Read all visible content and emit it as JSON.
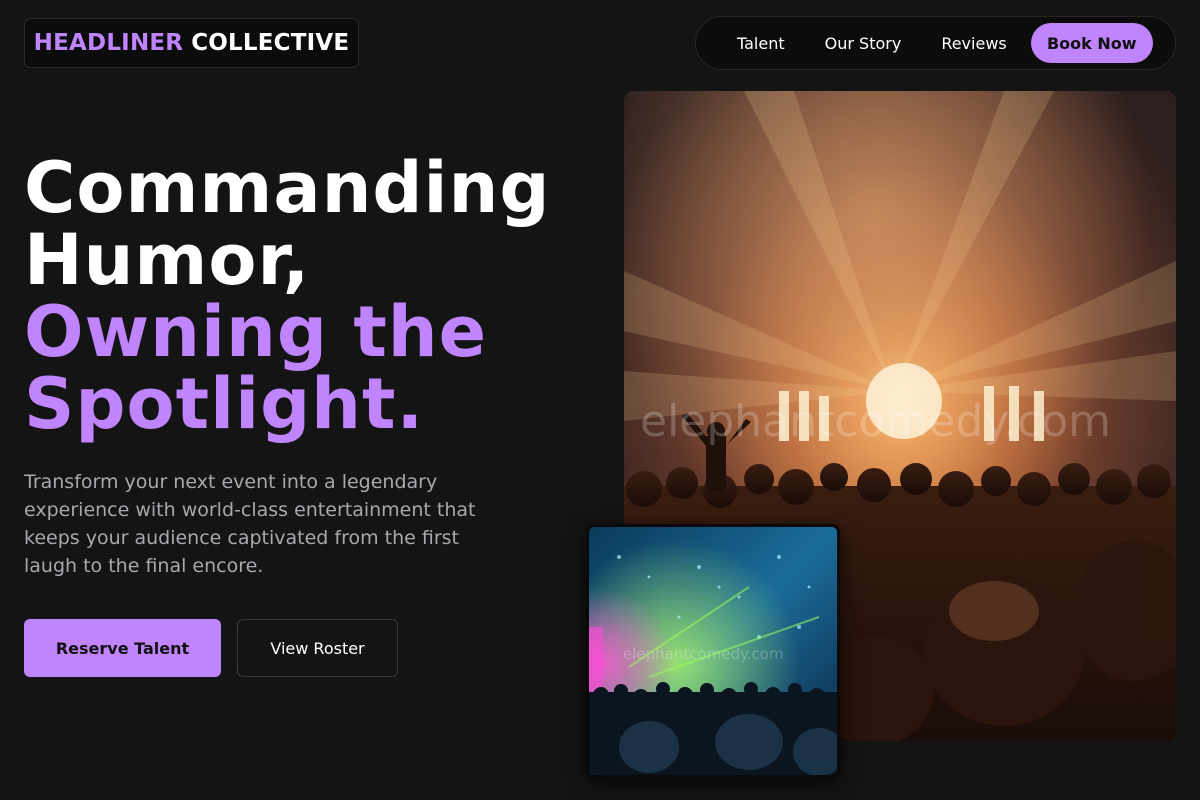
{
  "logo": {
    "accent": "HEADLINER",
    "rest": "COLLECTIVE"
  },
  "nav": {
    "links": [
      "Talent",
      "Our Story",
      "Reviews"
    ],
    "cta": "Book Now"
  },
  "hero": {
    "title_lines": [
      "Commanding",
      "Humor,",
      "Owning the",
      "Spotlight."
    ],
    "description": "Transform your next event into a legendary experience with world-class entertainment that keeps your audience captivated from the first laugh to the final encore.",
    "primary_button": "Reserve Talent",
    "secondary_button": "View Roster"
  },
  "images": {
    "main_watermark": "elephantcomedy.com",
    "thumb_watermark": "elephantcomedy.com"
  },
  "colors": {
    "accent": "#c084fc",
    "background": "#141414",
    "muted_text": "#a8a8ae"
  }
}
